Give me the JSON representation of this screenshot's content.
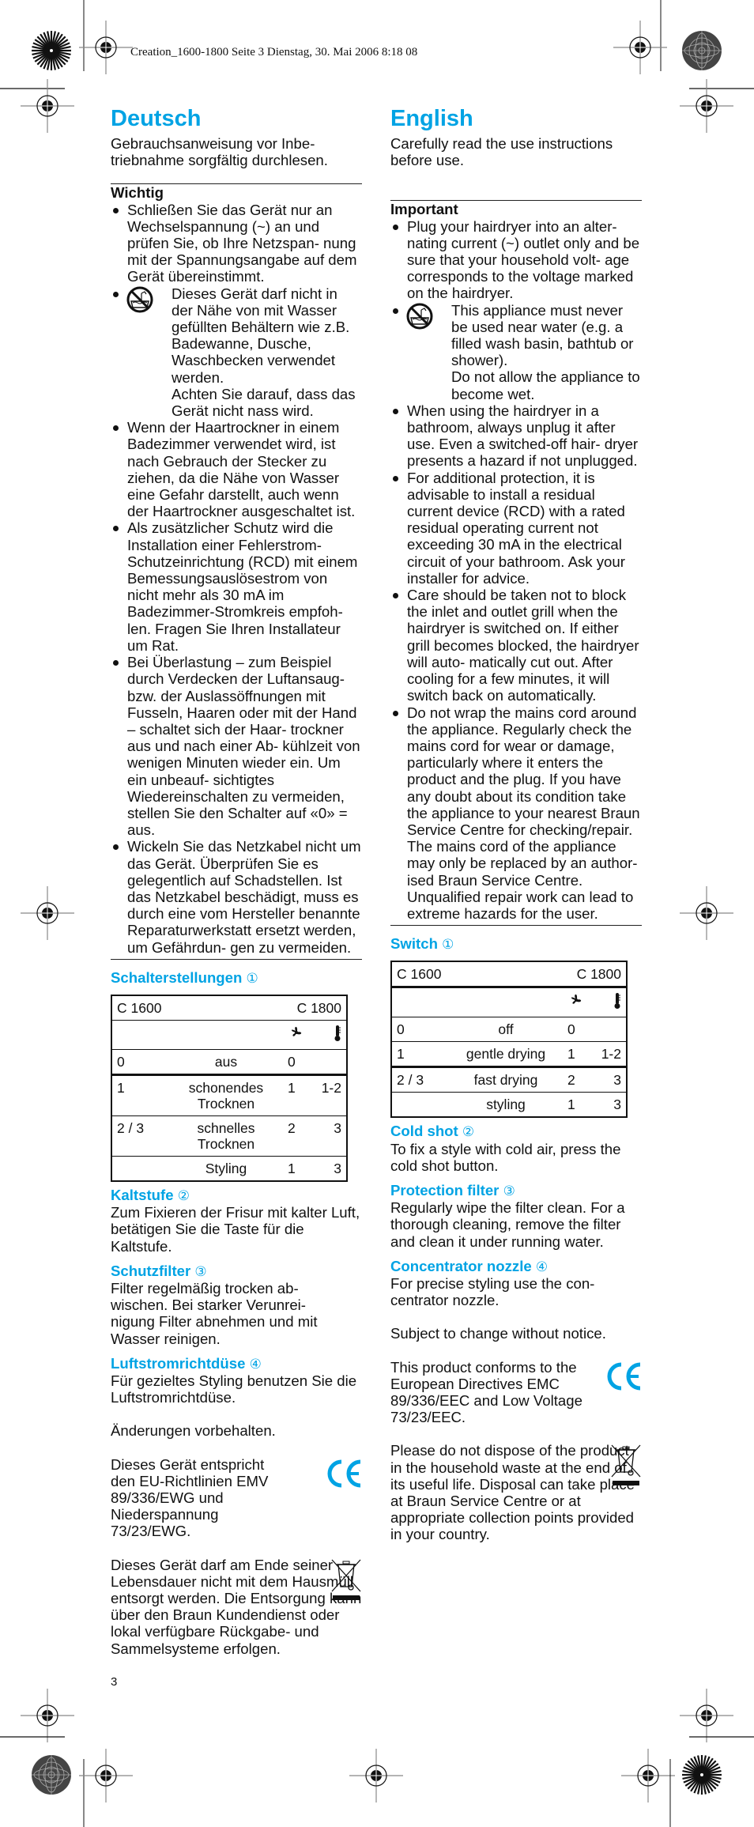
{
  "print_header": "Creation_1600-1800  Seite 3  Dienstag, 30. Mai 2006  8:18 08",
  "page_number": "3",
  "colors": {
    "accent": "#00a3e4",
    "text": "#111111"
  },
  "deutsch": {
    "title": "Deutsch",
    "intro": "Gebrauchsanweisung vor Inbe- triebnahme sorgfältig durchlesen.",
    "important_label": "Wichtig",
    "bullets": [
      "Schließen Sie das Gerät nur an Wechselspannung (~) an und prüfen Sie, ob Ihre Netzspan- nung mit der Spannungsangabe auf dem Gerät übereinstimmt.",
      "Dieses Gerät darf nicht in der Nähe von mit Wasser gefüllten Behältern wie z.B. Badewanne, Dusche, Waschbecken verwendet werden.",
      "Wenn der Haartrockner in einem Badezimmer verwendet wird, ist nach Gebrauch der Stecker zu ziehen, da die Nähe von Wasser eine Gefahr darstellt, auch wenn der Haartrockner ausgeschaltet ist.",
      "Als zusätzlicher Schutz wird die Installation einer Fehlerstrom- Schutzeinrichtung (RCD) mit einem Bemessungsauslösestrom von nicht mehr als 30 mA im Badezimmer-Stromkreis empfoh- len. Fragen Sie Ihren Installateur um Rat.",
      "Bei Überlastung – zum Beispiel durch Verdecken der Luftansaug- bzw. der Auslassöffnungen mit Fusseln, Haaren oder mit der Hand – schaltet sich der Haar- trockner aus und nach einer Ab- kühlzeit von wenigen Minuten wieder ein. Um ein unbeauf- sichtigtes Wiedereinschalten zu vermeiden, stellen Sie den Schalter auf «0» = aus.",
      "Wickeln Sie das Netzkabel nicht um das Gerät. Überprüfen Sie es gelegentlich auf Schadstellen. Ist das Netzkabel beschädigt, muss es durch eine vom Hersteller benannte Reparaturwerkstatt ersetzt werden, um Gefährdun- gen zu vermeiden."
    ],
    "water_warning_extra": "Achten Sie darauf, dass das Gerät nicht nass wird.",
    "water_icon": "no-water-warning-icon",
    "switch": {
      "heading": "Schalterstellungen",
      "heading_num": "①",
      "header_left": "C 1600",
      "header_right": "C 1800",
      "icons": {
        "fan": "fan-icon",
        "heat": "thermometer-icon"
      },
      "rows": [
        {
          "c1600": "0",
          "label": "aus",
          "fan": "0",
          "heat": ""
        },
        {
          "c1600": "1",
          "label": "schonendes Trocknen",
          "fan": "1",
          "heat": "1-2"
        },
        {
          "c1600": "2 / 3",
          "label": "schnelles Trocknen",
          "fan": "2",
          "heat": "3"
        },
        {
          "c1600": "",
          "label": "Styling",
          "fan": "1",
          "heat": "3"
        }
      ]
    },
    "sections": [
      {
        "heading": "Kaltstufe",
        "num": "②",
        "text": "Zum Fixieren der Frisur mit kalter Luft, betätigen Sie die Taste für die Kaltstufe."
      },
      {
        "heading": "Schutzfilter",
        "num": "③",
        "text": "Filter regelmäßig trocken ab- wischen. Bei starker Verunrei- nigung Filter abnehmen und mit Wasser reinigen."
      },
      {
        "heading": "Luftstromrichtdüse",
        "num": "④",
        "text": "Für gezieltes Styling benutzen Sie die Luftstromrichtdüse."
      }
    ],
    "change_notice": "Änderungen vorbehalten.",
    "ce_text": "Dieses Gerät entspricht den EU-Richtlinien EMV 89/336/EWG und Niederspannung 73/23/EWG.",
    "weee_text": "Dieses Gerät darf am Ende seiner Lebensdauer nicht mit dem Hausmüll entsorgt werden. Die Entsorgung kann über den Braun Kundendienst oder lokal verfügbare Rückgabe- und Sammelsysteme erfolgen."
  },
  "english": {
    "title": "English",
    "intro": "Carefully read the use instructions before use.",
    "important_label": "Important",
    "bullets": [
      "Plug your hairdryer into an alter- nating current (~) outlet only and be sure that your household volt- age corresponds to the voltage marked on the hairdryer.",
      "This appliance must never be used near water (e.g. a filled wash basin, bathtub or shower).",
      "When using the hairdryer in a bathroom, always unplug it after use. Even a switched-off hair- dryer presents a hazard if not unplugged.",
      "For additional protection, it is advisable to install a residual current device (RCD) with a rated residual operating current not exceeding 30 mA in the electrical circuit of your bathroom. Ask your installer for advice.",
      "Care should be taken not to block the inlet and outlet grill when the hairdryer is switched on. If either grill becomes blocked, the hairdryer will auto- matically cut out. After cooling for a few minutes, it will switch back on automatically.",
      "Do not wrap the mains cord around the appliance. Regularly check the mains cord for wear or damage, particularly where it enters the product and the plug. If you have any doubt about its condition take the appliance to your nearest Braun Service Centre for checking/repair. The mains cord of the appliance may only be replaced by an author- ised Braun Service Centre. Unqualified repair work can lead to extreme hazards for the user."
    ],
    "water_warning_extra": "Do not allow the appliance to become wet.",
    "water_icon": "no-water-warning-icon",
    "switch": {
      "heading": "Switch",
      "heading_num": "①",
      "header_left": "C 1600",
      "header_right": "C 1800",
      "icons": {
        "fan": "fan-icon",
        "heat": "thermometer-icon"
      },
      "rows": [
        {
          "c1600": "0",
          "label": "off",
          "fan": "0",
          "heat": ""
        },
        {
          "c1600": "1",
          "label": "gentle drying",
          "fan": "1",
          "heat": "1-2"
        },
        {
          "c1600": "2 / 3",
          "label": "fast drying",
          "fan": "2",
          "heat": "3"
        },
        {
          "c1600": "",
          "label": "styling",
          "fan": "1",
          "heat": "3"
        }
      ]
    },
    "sections": [
      {
        "heading": "Cold shot",
        "num": "②",
        "text": "To fix a style with cold air, press the cold shot button."
      },
      {
        "heading": "Protection filter",
        "num": "③",
        "text": "Regularly wipe the filter clean. For a thorough cleaning, remove the filter and clean it under running water."
      },
      {
        "heading": "Concentrator nozzle",
        "num": "④",
        "text": "For precise styling use the con- centrator nozzle."
      }
    ],
    "change_notice": "Subject to change without notice.",
    "ce_text": "This product conforms to the European Directives EMC 89/336/EEC and Low Voltage 73/23/EEC.",
    "weee_text": "Please do not dispose of the product in the household waste at the end of its useful life. Disposal can take place at Braun Service Centre or at appropriate collection points provided in your country."
  }
}
